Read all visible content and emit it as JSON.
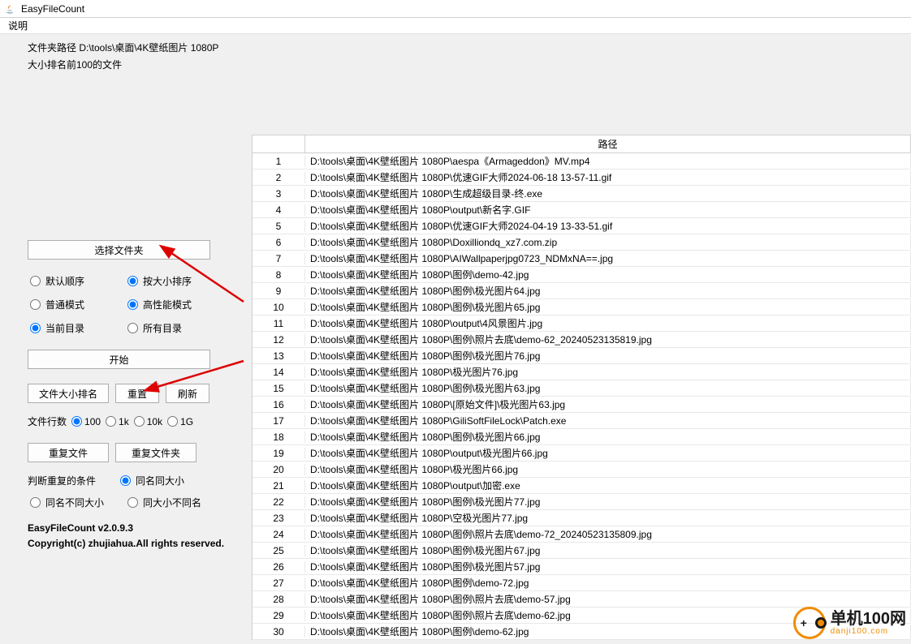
{
  "window": {
    "title": "EasyFileCount"
  },
  "menu": {
    "shuoming": "说明"
  },
  "info": {
    "path_line": "文件夹路径 D:\\tools\\桌面\\4K壁纸图片 1080P",
    "rank_line": "大小排名前100的文件"
  },
  "buttons": {
    "choose_folder": "选择文件夹",
    "start": "开始",
    "file_size_rank": "文件大小排名",
    "reset": "重置",
    "refresh": "刷新",
    "dup_file": "重复文件",
    "dup_folder": "重复文件夹"
  },
  "radios": {
    "default_order": "默认顺序",
    "by_size": "按大小排序",
    "normal_mode": "普通模式",
    "high_perf": "高性能模式",
    "current_dir": "当前目录",
    "all_dir": "所有目录"
  },
  "row_count": {
    "label": "文件行数",
    "r100": "100",
    "r1k": "1k",
    "r10k": "10k",
    "r1g": "1G"
  },
  "dup_cond": {
    "label": "判断重复的条件",
    "same_name_size": "同名同大小",
    "same_name_diff_size": "同名不同大小",
    "same_size_diff_name": "同大小不同名"
  },
  "footer": {
    "version": "EasyFileCount v2.0.9.3",
    "copyright": "Copyright(c) zhujiahua.All rights reserved."
  },
  "table": {
    "header_path": "路径",
    "rows": [
      "D:\\tools\\桌面\\4K壁纸图片 1080P\\aespa《Armageddon》MV.mp4",
      "D:\\tools\\桌面\\4K壁纸图片 1080P\\优速GIF大师2024-06-18 13-57-11.gif",
      "D:\\tools\\桌面\\4K壁纸图片 1080P\\生成超级目录-终.exe",
      "D:\\tools\\桌面\\4K壁纸图片 1080P\\output\\新名字.GIF",
      "D:\\tools\\桌面\\4K壁纸图片 1080P\\优速GIF大师2024-04-19 13-33-51.gif",
      "D:\\tools\\桌面\\4K壁纸图片 1080P\\Doxilliondq_xz7.com.zip",
      "D:\\tools\\桌面\\4K壁纸图片 1080P\\AIWallpaperjpg0723_NDMxNA==.jpg",
      "D:\\tools\\桌面\\4K壁纸图片 1080P\\图例\\demo-42.jpg",
      "D:\\tools\\桌面\\4K壁纸图片 1080P\\图例\\极光图片64.jpg",
      "D:\\tools\\桌面\\4K壁纸图片 1080P\\图例\\极光图片65.jpg",
      "D:\\tools\\桌面\\4K壁纸图片 1080P\\output\\4风景图片.jpg",
      "D:\\tools\\桌面\\4K壁纸图片 1080P\\图例\\照片去底\\demo-62_20240523135819.jpg",
      "D:\\tools\\桌面\\4K壁纸图片 1080P\\图例\\极光图片76.jpg",
      "D:\\tools\\桌面\\4K壁纸图片 1080P\\极光图片76.jpg",
      "D:\\tools\\桌面\\4K壁纸图片 1080P\\图例\\极光图片63.jpg",
      "D:\\tools\\桌面\\4K壁纸图片 1080P\\[原始文件]\\极光图片63.jpg",
      "D:\\tools\\桌面\\4K壁纸图片 1080P\\GiliSoftFileLock\\Patch.exe",
      "D:\\tools\\桌面\\4K壁纸图片 1080P\\图例\\极光图片66.jpg",
      "D:\\tools\\桌面\\4K壁纸图片 1080P\\output\\极光图片66.jpg",
      "D:\\tools\\桌面\\4K壁纸图片 1080P\\极光图片66.jpg",
      "D:\\tools\\桌面\\4K壁纸图片 1080P\\output\\加密.exe",
      "D:\\tools\\桌面\\4K壁纸图片 1080P\\图例\\极光图片77.jpg",
      "D:\\tools\\桌面\\4K壁纸图片 1080P\\空极光图片77.jpg",
      "D:\\tools\\桌面\\4K壁纸图片 1080P\\图例\\照片去底\\demo-72_20240523135809.jpg",
      "D:\\tools\\桌面\\4K壁纸图片 1080P\\图例\\极光图片67.jpg",
      "D:\\tools\\桌面\\4K壁纸图片 1080P\\图例\\极光图片57.jpg",
      "D:\\tools\\桌面\\4K壁纸图片 1080P\\图例\\demo-72.jpg",
      "D:\\tools\\桌面\\4K壁纸图片 1080P\\图例\\照片去底\\demo-57.jpg",
      "D:\\tools\\桌面\\4K壁纸图片 1080P\\图例\\照片去底\\demo-62.jpg",
      "D:\\tools\\桌面\\4K壁纸图片 1080P\\图例\\demo-62.jpg"
    ]
  },
  "watermark": {
    "text": "单机100网",
    "sub": "danji100.com"
  }
}
